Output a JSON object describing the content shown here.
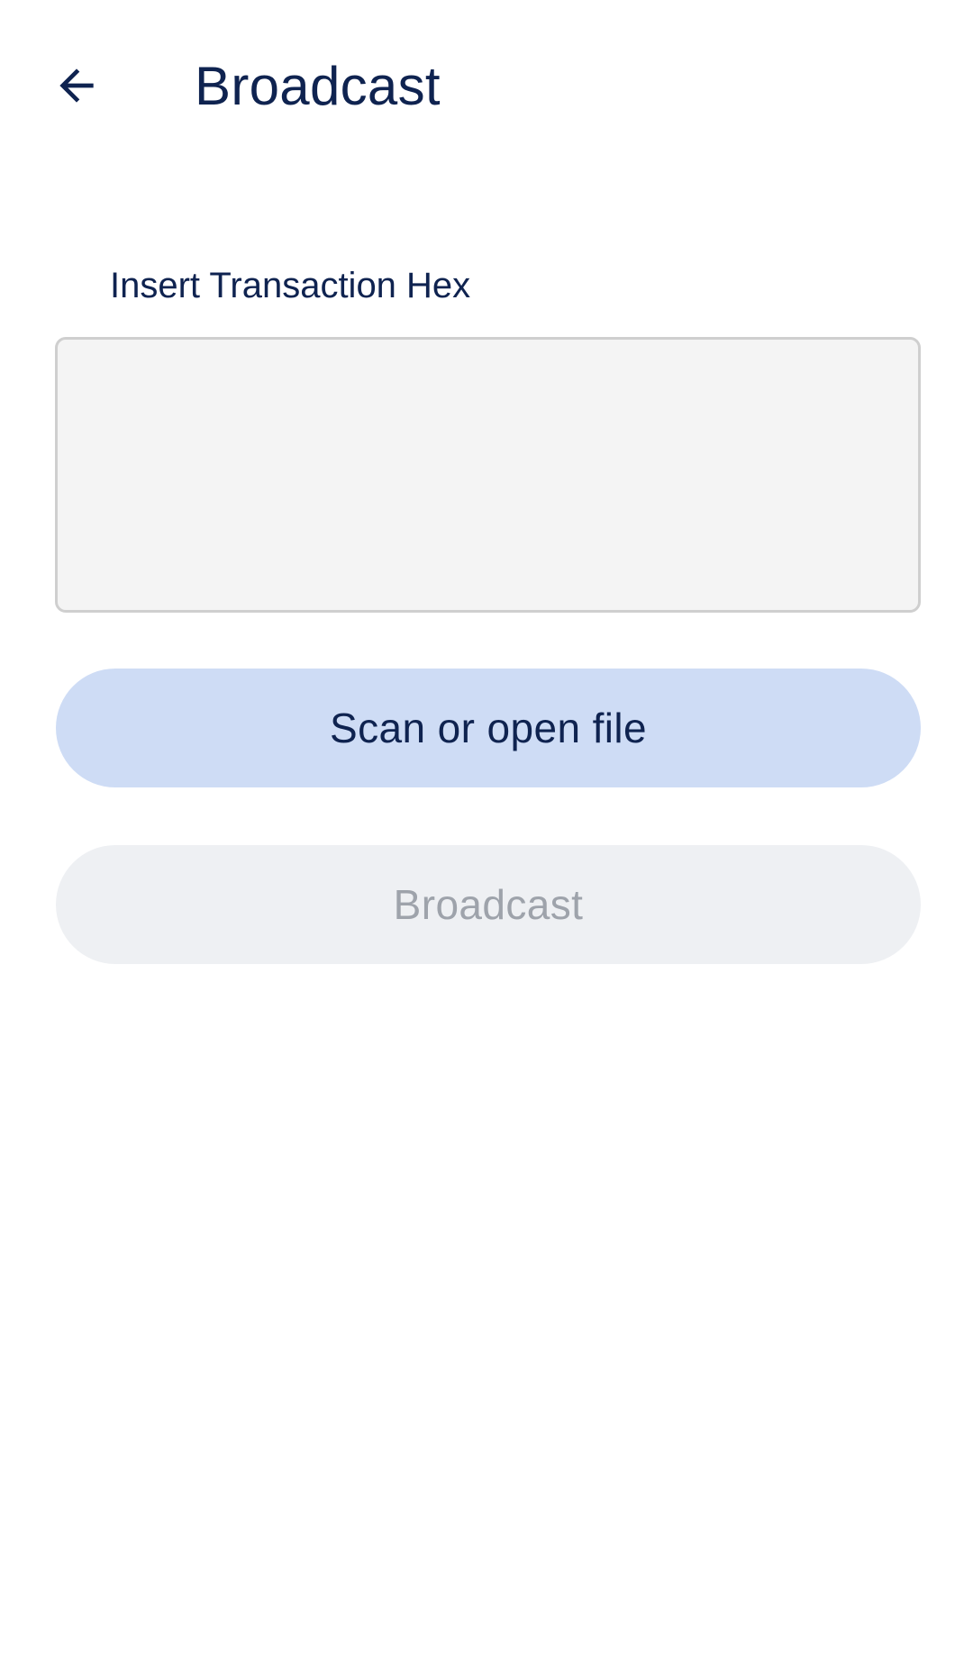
{
  "header": {
    "title": "Broadcast",
    "back_icon": "arrow-left-icon"
  },
  "form": {
    "label": "Insert Transaction Hex",
    "hex_value": "",
    "placeholder": ""
  },
  "actions": {
    "scan_label": "Scan or open file",
    "broadcast_label": "Broadcast",
    "broadcast_enabled": false
  },
  "colors": {
    "text_primary": "#0f2350",
    "scan_button_bg": "#cedcf5",
    "broadcast_disabled_bg": "#eef0f3",
    "broadcast_disabled_text": "#9ea3ab",
    "input_bg": "#f4f4f4",
    "input_border": "#cfcfcf"
  }
}
